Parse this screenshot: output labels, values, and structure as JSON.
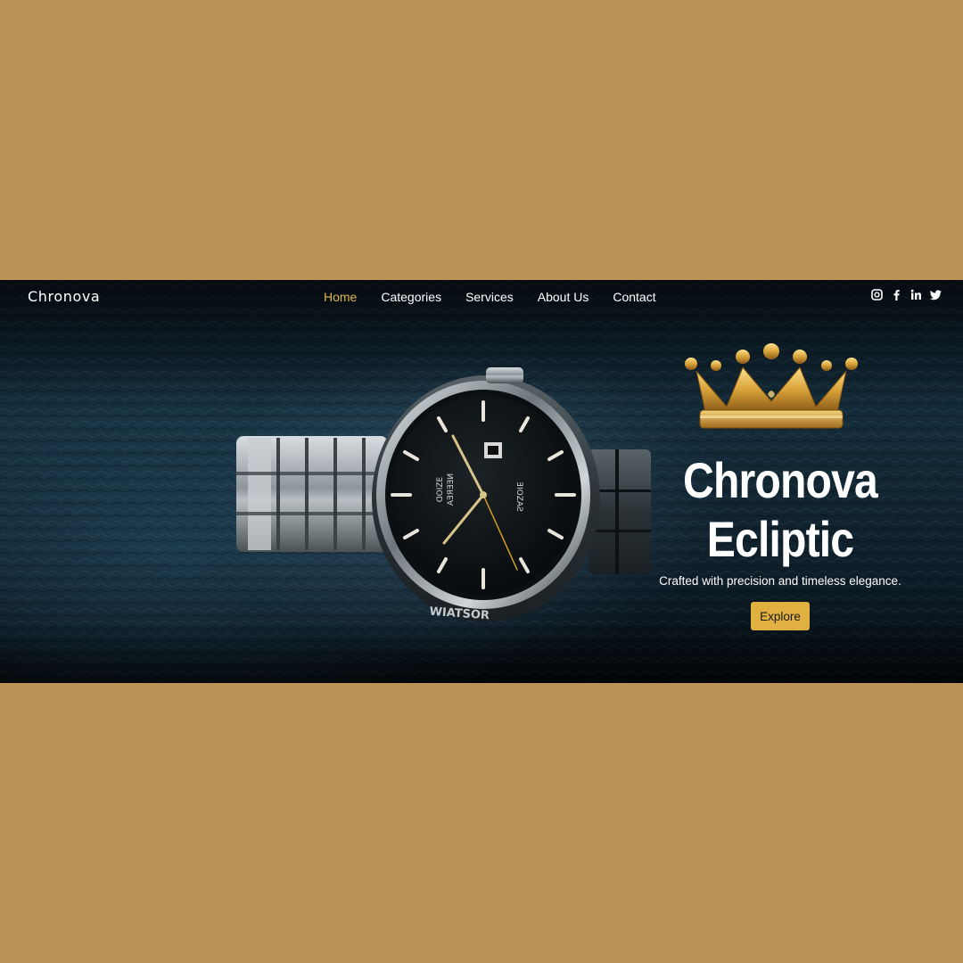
{
  "nav": {
    "brand": "Chronova",
    "items": [
      {
        "label": "Home",
        "active": true
      },
      {
        "label": "Categories",
        "active": false
      },
      {
        "label": "Services",
        "active": false
      },
      {
        "label": "About Us",
        "active": false
      },
      {
        "label": "Contact",
        "active": false
      }
    ],
    "social": [
      "instagram-icon",
      "facebook-icon",
      "linkedin-icon",
      "twitter-icon"
    ]
  },
  "hero": {
    "title_line1": "Chronova",
    "title_line2": "Ecliptic",
    "subtitle": "Crafted with precision and timeless elegance.",
    "cta": "Explore"
  },
  "watch": {
    "dial_text_left_1": "ꓷOIZE",
    "dial_text_left_2": "AƎЯƎƎИ",
    "dial_text_right": "ƎIOZAƧ",
    "bezel_text": "WIATSOR"
  },
  "colors": {
    "page_bg": "#bb9356",
    "accent": "#e0b550",
    "button": "#e0b040"
  }
}
